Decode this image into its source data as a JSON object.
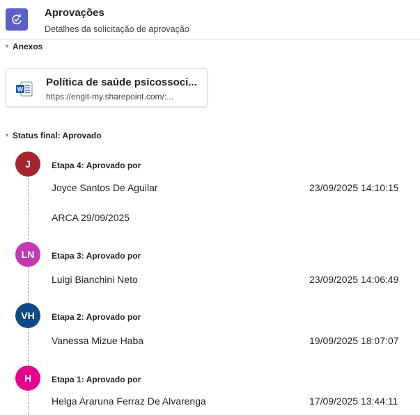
{
  "header": {
    "title": "Aprovações",
    "subtitle": "Detalhes da solicitação de aprovação",
    "icon": "approvals-icon",
    "accent_color": "#5b5fc7"
  },
  "attachments": {
    "section_label": "Anexos",
    "items": [
      {
        "title": "Política de saúde psicossoci...",
        "url": "https://engit-my.sharepoint.com/:...",
        "icon": "word-document-icon"
      }
    ]
  },
  "status": {
    "section_label": "Status final: Aprovado",
    "steps": [
      {
        "label": "Etapa 4: Aprovado por",
        "initials": "J",
        "avatar_color": "#a4262c",
        "approver": "Joyce Santos De Aguilar",
        "timestamp": "23/09/2025 14:10:15",
        "comment": "ARCA 29/09/2025"
      },
      {
        "label": "Etapa 3: Aprovado por",
        "initials": "LN",
        "avatar_color": "#c239b3",
        "approver": "Luigi Bianchini Neto",
        "timestamp": "23/09/2025 14:06:49"
      },
      {
        "label": "Etapa 2: Aprovado por",
        "initials": "VH",
        "avatar_color": "#0f4a85",
        "approver": "Vanessa Mizue Haba",
        "timestamp": "19/09/2025 18:07:07"
      },
      {
        "label": "Etapa 1: Aprovado por",
        "initials": "H",
        "avatar_color": "#e3008c",
        "approver": "Helga Araruna Ferraz De Alvarenga",
        "timestamp": "17/09/2025 13:44:11"
      }
    ]
  }
}
